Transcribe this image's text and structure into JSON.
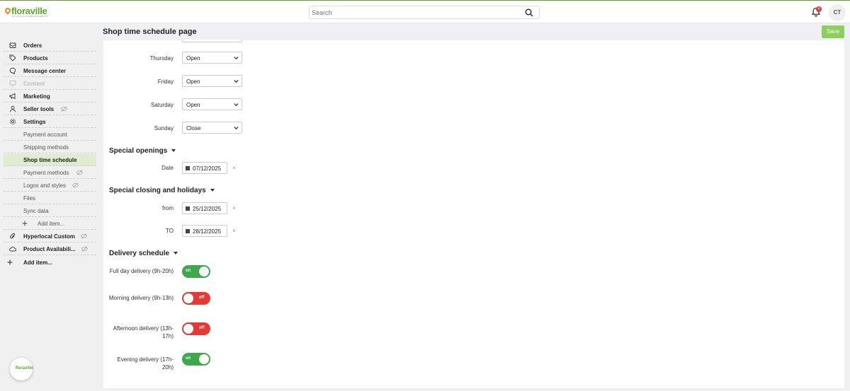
{
  "app": {
    "logo_text": "floraville",
    "logo_tagline": "BOUQUETS & ARRANGEMENTS"
  },
  "search": {
    "placeholder": "Search"
  },
  "notifications": {
    "count": "4"
  },
  "user": {
    "initials": "CT"
  },
  "sidebar": {
    "items": [
      {
        "label": "Orders",
        "icon": "mail-icon"
      },
      {
        "label": "Products",
        "icon": "tag-icon"
      },
      {
        "label": "Message center",
        "icon": "chat-icon"
      },
      {
        "label": "Content",
        "icon": "monitor-icon"
      },
      {
        "label": "Marketing",
        "icon": "megaphone-icon"
      },
      {
        "label": "Seller tools",
        "icon": "user-icon"
      },
      {
        "label": "Settings",
        "icon": "gear-icon"
      }
    ],
    "settings_sub": [
      {
        "label": "Payment account"
      },
      {
        "label": "Shipping methods"
      },
      {
        "label": "Shop time schedule"
      },
      {
        "label": "Payment methods"
      },
      {
        "label": "Logos and styles"
      },
      {
        "label": "Files"
      },
      {
        "label": "Sync data"
      },
      {
        "label": "Add item..."
      }
    ],
    "more": [
      {
        "label": "Hyperlocal Custom",
        "icon": "paperclip-icon"
      },
      {
        "label": "Product Availabili...",
        "icon": "cloud-icon"
      },
      {
        "label": "Add item..."
      }
    ]
  },
  "header": {
    "title": "Shop time schedule page",
    "save_label": "Save"
  },
  "weekdays": [
    {
      "day": "Thursday",
      "value": "Open"
    },
    {
      "day": "Friday",
      "value": "Open"
    },
    {
      "day": "Saturday",
      "value": "Open"
    },
    {
      "day": "Sunday",
      "value": "Close"
    }
  ],
  "special_openings": {
    "title": "Special openings",
    "date_label": "Date",
    "date": "07/12/2025"
  },
  "special_closing": {
    "title": "Special closing and holidays",
    "from_label": "from",
    "from": "25/12/2025",
    "to_label": "TO",
    "to": "28/12/2025"
  },
  "delivery": {
    "title": "Delivery schedule",
    "rows": [
      {
        "label": "Full day delivery (9h-20h)",
        "state": "on"
      },
      {
        "label": "Morning delivery (9h-13h)",
        "state": "off"
      },
      {
        "label": "Afternoon delivery (13h-17h)",
        "state": "off"
      },
      {
        "label": "Evening delivery (17h-20h)",
        "state": "on"
      }
    ]
  },
  "colors": {
    "brand_green": "#5aaa2a",
    "toggle_on": "#3fa84c",
    "toggle_off": "#e53935",
    "save": "#8dcf5f"
  }
}
